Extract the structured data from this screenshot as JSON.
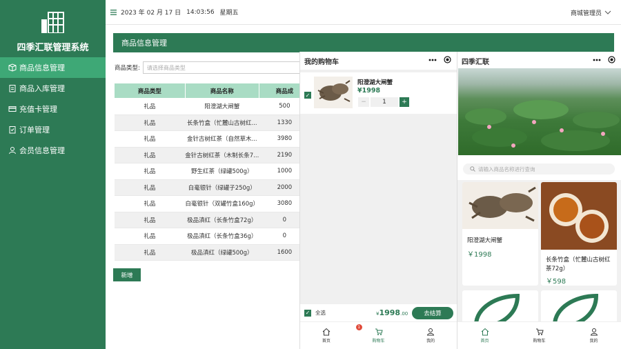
{
  "sidebar": {
    "title": "四季汇联管理系统",
    "items": [
      {
        "label": "商品信息管理",
        "icon": "box-icon"
      },
      {
        "label": "商品入库管理",
        "icon": "clipboard-icon"
      },
      {
        "label": "充值卡管理",
        "icon": "card-icon"
      },
      {
        "label": "订单管理",
        "icon": "order-icon"
      },
      {
        "label": "会员信息管理",
        "icon": "user-icon"
      }
    ]
  },
  "topbar": {
    "date": "2023 年 02 月 17 日",
    "time": "14:03:56",
    "weekday": "星期五",
    "admin": "商城管理员"
  },
  "panel": {
    "title": "商品信息管理",
    "filter_label": "商品类型:",
    "filter_placeholder": "请选择商品类型",
    "add_button": "新增"
  },
  "table": {
    "headers": [
      "商品类型",
      "商品名称",
      "商品成"
    ],
    "rows": [
      [
        "礼品",
        "阳澄湖大闸蟹",
        "500"
      ],
      [
        "礼品",
        "长条竹盒（忙麓山古树红...",
        "1330"
      ],
      [
        "礼品",
        "金针古树红茶（自然草木...",
        "3980"
      ],
      [
        "礼品",
        "金针古树红茶（木制长条7...",
        "2190"
      ],
      [
        "礼品",
        "野生红茶（绿罐500g）",
        "1000"
      ],
      [
        "礼品",
        "白毫银针（绿罐子250g）",
        "2000"
      ],
      [
        "礼品",
        "白毫银针（双罐竹盒160g）",
        "3080"
      ],
      [
        "礼品",
        "极品滇红（长条竹盒72g）",
        "0"
      ],
      [
        "礼品",
        "极品滇红（长条竹盒36g）",
        "0"
      ],
      [
        "礼品",
        "极品滇红（绿罐500g）",
        "1600"
      ]
    ]
  },
  "cart": {
    "title": "我的购物车",
    "item_name": "阳澄湖大闸蟹",
    "item_price": "¥1998",
    "qty_minus": "−",
    "qty": "1",
    "qty_plus": "+",
    "select_all": "全选",
    "total_symbol": "¥",
    "total_int": "1998",
    "total_dec": ".00",
    "checkout": "去结算",
    "tabs": [
      {
        "label": "首页"
      },
      {
        "label": "购物车",
        "badge": "1"
      },
      {
        "label": "我的"
      }
    ]
  },
  "shop": {
    "title": "四季汇联",
    "search_placeholder": "请输入商品名称进行查询",
    "products": [
      {
        "name": "阳澄湖大闸蟹",
        "price": "￥1998"
      },
      {
        "name": "长条竹盒（忙麓山古树红茶72g）",
        "price": "￥598"
      }
    ],
    "tabs": [
      {
        "label": "首页"
      },
      {
        "label": "购物车"
      },
      {
        "label": "我的"
      }
    ]
  },
  "colors": {
    "brand": "#2d7a55",
    "active": "#3ea876",
    "header_cell": "#a9dcc4"
  }
}
